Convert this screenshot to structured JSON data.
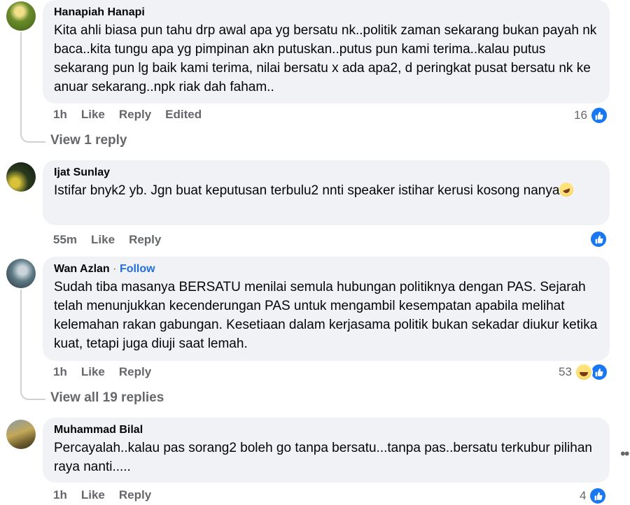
{
  "comments": [
    {
      "name": "Hanapiah Hanapi",
      "text": "Kita ahli biasa pun tahu drp awal apa yg bersatu nk..politik zaman sekarang bukan payah nk baca..kita tungu apa yg pimpinan akn putuskan..putus pun kami terima..kalau putus sekarang pun lg baik kami terima, nilai bersatu x ada apa2, d peringkat pusat bersatu nk ke anuar sekarang..npk riak dah faham..",
      "time": "1h",
      "like": "Like",
      "reply": "Reply",
      "edited": "Edited",
      "reactions": "16",
      "view_replies": "View 1 reply"
    },
    {
      "name": "Ijat Sunlay",
      "text": "Istifar bnyk2 yb. Jgn buat keputusan terbulu2 nnti speaker istihar kerusi kosong nanya",
      "time": "55m",
      "like": "Like",
      "reply": "Reply",
      "reactions": ""
    },
    {
      "name": "Wan Azlan",
      "follow": "Follow",
      "text": "Sudah tiba masanya BERSATU menilai semula hubungan politiknya dengan PAS. Sejarah telah menunjukkan kecenderungan PAS untuk mengambil kesempatan apabila melihat kelemahan rakan gabungan. Kesetiaan dalam kerjasama politik bukan sekadar diukur ketika kuat, tetapi juga diuji saat lemah.",
      "time": "1h",
      "like": "Like",
      "reply": "Reply",
      "reactions": "53",
      "view_replies": "View all 19 replies"
    },
    {
      "name": "Muhammad Bilal",
      "text": "Percayalah..kalau pas sorang2 boleh go tanpa bersatu...tanpa pas..bersatu terkubur pilihan raya nanti.....",
      "time": "1h",
      "like": "Like",
      "reply": "Reply",
      "reactions": "4"
    }
  ],
  "icons": {
    "like": "like-icon",
    "haha": "haha-icon",
    "laugh_emoji": "rolling-laughing-emoji",
    "more": "more-options-icon"
  },
  "colors": {
    "bubble": "#f0f2f5",
    "link": "#216fdb",
    "meta": "#65676b",
    "like_blue": "#1877f2"
  }
}
